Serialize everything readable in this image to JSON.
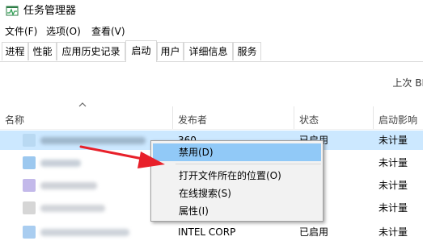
{
  "window": {
    "title": "任务管理器"
  },
  "menu": [
    "文件(F)",
    "选项(O)",
    "查看(V)"
  ],
  "tabs": [
    {
      "label": "进程",
      "active": false
    },
    {
      "label": "性能",
      "active": false
    },
    {
      "label": "应用历史记录",
      "active": false
    },
    {
      "label": "启动",
      "active": true
    },
    {
      "label": "用户",
      "active": false
    },
    {
      "label": "详细信息",
      "active": false
    },
    {
      "label": "服务",
      "active": false
    }
  ],
  "last_bios_label": "上次 BI",
  "columns": {
    "name": "名称",
    "publisher": "发布者",
    "status": "状态",
    "impact": "启动影响"
  },
  "rows": [
    {
      "publisher": "360 ...",
      "status": "已启用",
      "impact": "未计量",
      "selected": true,
      "icon_color": "#7ab7e6"
    },
    {
      "publisher": "",
      "status": "",
      "impact": "未计量",
      "selected": false,
      "icon_color": "#3b8fde"
    },
    {
      "publisher": "",
      "status": "",
      "impact": "未计量",
      "selected": false,
      "icon_color": "#8a7bd1"
    },
    {
      "publisher": "",
      "status": "",
      "impact": "未计量",
      "selected": false,
      "icon_color": "#9a9a9a"
    },
    {
      "publisher": "INTEL CORP",
      "status": "已启用",
      "impact": "未计量",
      "selected": false,
      "icon_color": "#4a90d9"
    }
  ],
  "context_menu": {
    "items": [
      {
        "label": "禁用(D)",
        "highlighted": true
      },
      {
        "label": "打开文件所在的位置(O)",
        "highlighted": false
      },
      {
        "label": "在线搜索(S)",
        "highlighted": false
      },
      {
        "label": "属性(I)",
        "highlighted": false
      }
    ]
  },
  "annotation": {
    "arrow_color": "#e8202a"
  }
}
